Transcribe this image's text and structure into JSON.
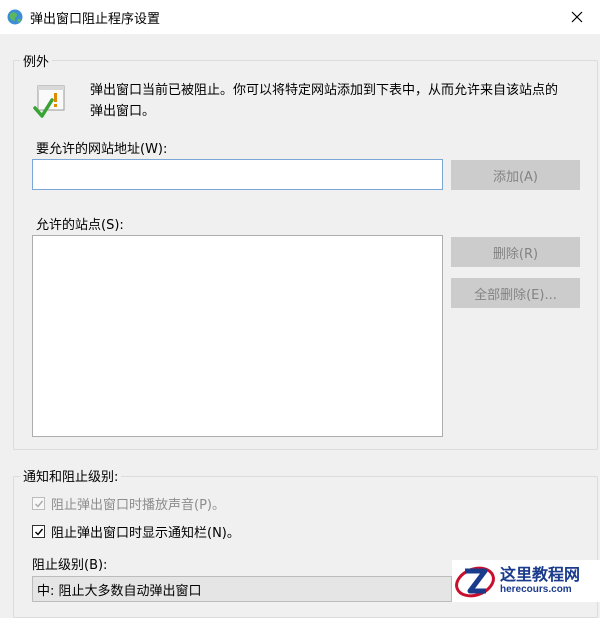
{
  "window": {
    "title": "弹出窗口阻止程序设置",
    "app_icon": "ie-globe-icon",
    "close_icon": "close-icon"
  },
  "exceptions": {
    "group_label": "例外",
    "info_icon": "warning-check-icon",
    "info_text": "弹出窗口当前已被阻止。你可以将特定网站添加到下表中，从而允许来自该站点的弹出窗口。",
    "address_label": "要允许的网站地址(W):",
    "address_value": "",
    "add_button": "添加(A)",
    "allowed_sites_label": "允许的站点(S):",
    "allowed_sites": [],
    "remove_button": "删除(R)",
    "remove_all_button": "全部删除(E)..."
  },
  "notifications": {
    "group_label": "通知和阻止级别:",
    "play_sound_label": "阻止弹出窗口时播放声音(P)。",
    "play_sound_checked": true,
    "play_sound_enabled": false,
    "show_bar_label": "阻止弹出窗口时显示通知栏(N)。",
    "show_bar_checked": true,
    "block_level_label": "阻止级别(B):",
    "block_level_value": "中: 阻止大多数自动弹出窗口"
  },
  "watermark": {
    "cn": "这里教程网",
    "en": "herecours.com"
  },
  "colors": {
    "accent_border": "#7aa7d6",
    "disabled_button": "#cccccc",
    "watermark_blue": "#1a3a8c",
    "watermark_red": "#c8102e"
  }
}
